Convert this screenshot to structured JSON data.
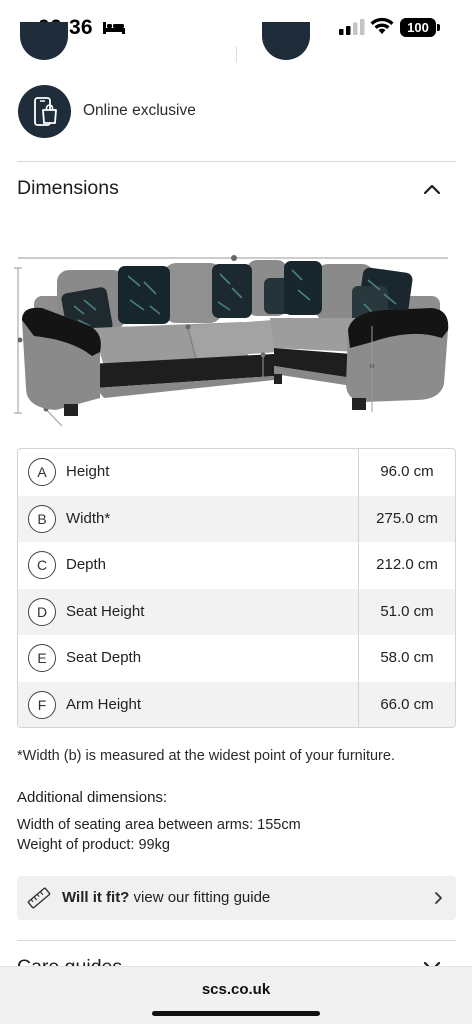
{
  "status_bar": {
    "time": "06:36",
    "battery": "100"
  },
  "feature": {
    "label": "Online exclusive",
    "icon": "mobile-shopping-bag-icon"
  },
  "section": {
    "title": "Dimensions",
    "expanded": true
  },
  "dimensions": [
    {
      "letter": "A",
      "name": "Height",
      "value": "96.0 cm"
    },
    {
      "letter": "B",
      "name": "Width*",
      "value": "275.0 cm"
    },
    {
      "letter": "C",
      "name": "Depth",
      "value": "212.0 cm"
    },
    {
      "letter": "D",
      "name": "Seat Height",
      "value": "51.0 cm"
    },
    {
      "letter": "E",
      "name": "Seat Depth",
      "value": "58.0 cm"
    },
    {
      "letter": "F",
      "name": "Arm Height",
      "value": "66.0 cm"
    }
  ],
  "note": "*Width (b) is measured at the widest point of your furniture.",
  "additional": {
    "title": "Additional dimensions:",
    "lines": [
      "Width of seating area between arms: 155cm",
      "Weight of product: 99kg"
    ]
  },
  "fit_banner": {
    "strong": "Will it fit?",
    "text": " view our fitting guide"
  },
  "next_section": {
    "title": "Care guides"
  },
  "browser": {
    "url": "scs.co.uk"
  },
  "colors": {
    "brand_navy": "#1f2c3a",
    "row_alt": "#f2f2f2",
    "banner_bg": "#f0f0f0"
  }
}
